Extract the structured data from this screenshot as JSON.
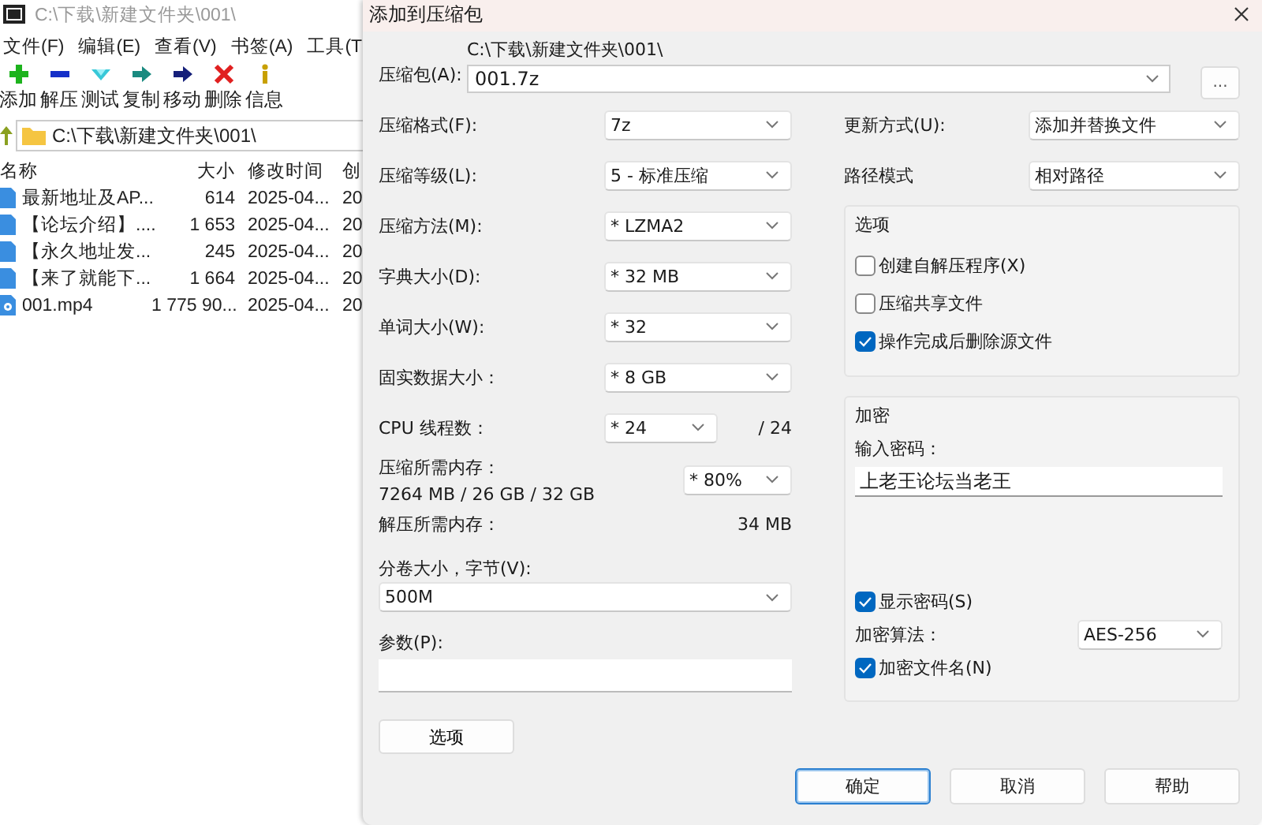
{
  "main_window": {
    "title": "C:\\下载\\新建文件夹\\001\\",
    "menu": [
      "文件(F)",
      "编辑(E)",
      "查看(V)",
      "书签(A)",
      "工具(T"
    ],
    "toolbar": [
      {
        "kind": "add",
        "label": "添加"
      },
      {
        "kind": "extract",
        "label": "解压"
      },
      {
        "kind": "test",
        "label": "测试"
      },
      {
        "kind": "copy",
        "label": "复制"
      },
      {
        "kind": "move",
        "label": "移动"
      },
      {
        "kind": "delete",
        "label": "删除"
      },
      {
        "kind": "info",
        "label": "信息"
      }
    ],
    "address": "C:\\下载\\新建文件夹\\001\\",
    "columns": [
      "名称",
      "大小",
      "修改时间",
      "创"
    ],
    "rows": [
      {
        "kind": "document",
        "name": "最新地址及AP...",
        "size": "614",
        "modified": "2025-04...",
        "column_4": "20"
      },
      {
        "kind": "document",
        "name": "【论坛介绍】....",
        "size": "1 653",
        "modified": "2025-04...",
        "column_4": "20"
      },
      {
        "kind": "document",
        "name": "【永久地址发...",
        "size": "245",
        "modified": "2025-04...",
        "column_4": "20"
      },
      {
        "kind": "document",
        "name": "【来了就能下...",
        "size": "1 664",
        "modified": "2025-04...",
        "column_4": "20"
      },
      {
        "kind": "video",
        "name": "001.mp4",
        "size": "1 775 90...",
        "modified": "2025-04...",
        "column_4": "20"
      }
    ]
  },
  "dialog": {
    "title": "添加到压缩包",
    "archive": {
      "label": "压缩包(A):",
      "folder": "C:\\下载\\新建文件夹\\001\\",
      "value": "001.7z",
      "browse": "..."
    },
    "settings": [
      {
        "label": "压缩格式(F):",
        "value": "7z"
      },
      {
        "label": "压缩等级(L):",
        "value": "5 - 标准压缩"
      },
      {
        "label": "压缩方法(M):",
        "value": "* LZMA2"
      },
      {
        "label": "字典大小(D):",
        "value": "* 32 MB"
      },
      {
        "label": "单词大小(W):",
        "value": "* 32"
      },
      {
        "label": "固实数据大小：",
        "value": "* 8 GB"
      }
    ],
    "threads": {
      "label": "CPU 线程数：",
      "value": "* 24",
      "max": "/ 24"
    },
    "memory": {
      "label": "压缩所需内存：",
      "usage": "7264 MB / 26 GB / 32 GB",
      "value": "* 80%"
    },
    "decompress_memory": {
      "label": "解压所需内存：",
      "value": "34 MB"
    },
    "volume": {
      "label": "分卷大小，字节(V):",
      "value": "500M"
    },
    "parameters": {
      "label": "参数(P):"
    },
    "options_button": "选项",
    "right_settings": [
      {
        "label": "更新方式(U):",
        "value": "添加并替换文件"
      },
      {
        "label": "路径模式",
        "value": "相对路径"
      }
    ],
    "options_group": {
      "title": "选项",
      "items": [
        {
          "label": "创建自解压程序(X)",
          "checked": false
        },
        {
          "label": "压缩共享文件",
          "checked": false
        },
        {
          "label": "操作完成后删除源文件",
          "checked": true
        }
      ]
    },
    "encryption": {
      "title": "加密",
      "password_label": "输入密码：",
      "password": "上老王论坛当老王",
      "show_password": {
        "label": "显示密码(S)",
        "checked": true
      },
      "algorithm": {
        "label": "加密算法：",
        "value": "AES-256"
      },
      "encrypt_names": {
        "label": "加密文件名(N)",
        "checked": true
      }
    },
    "buttons": [
      {
        "label": "确定",
        "default": true
      },
      {
        "label": "取消",
        "default": false
      },
      {
        "label": "帮助",
        "default": false
      }
    ]
  }
}
